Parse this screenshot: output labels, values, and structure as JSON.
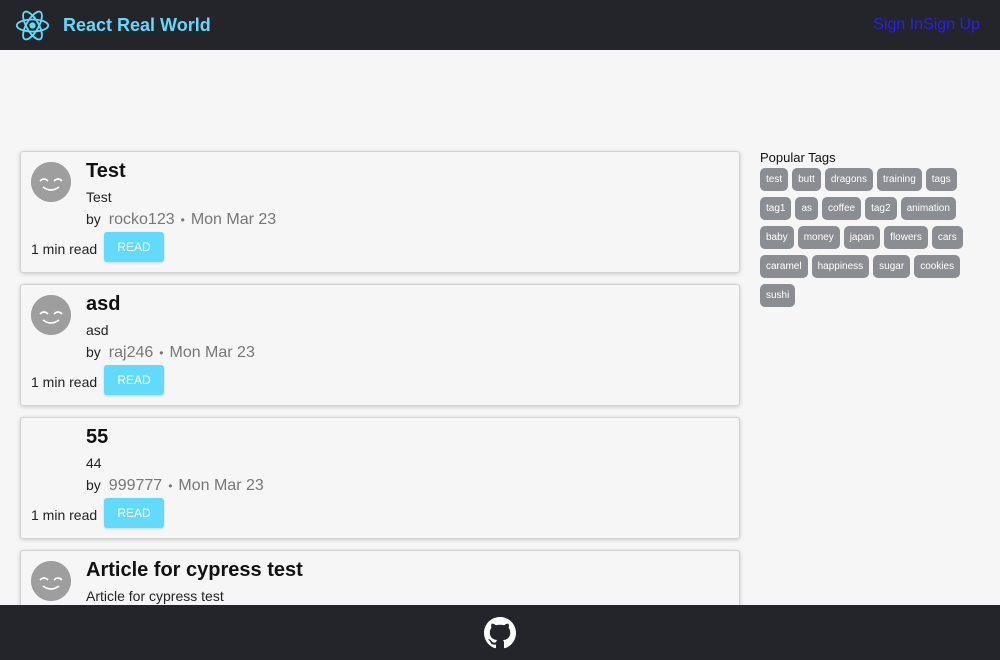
{
  "header": {
    "logo_icon": "react-atom-icon",
    "title": "React Real World",
    "sign_in": "Sign In",
    "sign_up": "Sign Up",
    "brand_color": "#61dafb",
    "link_color": "#2a1ef0"
  },
  "articles": [
    {
      "title": "Test",
      "description": "Test",
      "by": "by",
      "author": "rocko123",
      "date": "Mon Mar 23",
      "read_time": "1 min read",
      "read_label": "READ",
      "has_avatar": true
    },
    {
      "title": "asd",
      "description": "asd",
      "by": "by",
      "author": "raj246",
      "date": "Mon Mar 23",
      "read_time": "1 min read",
      "read_label": "READ",
      "has_avatar": true
    },
    {
      "title": "55",
      "description": "44",
      "by": "by",
      "author": "999777",
      "date": "Mon Mar 23",
      "read_time": "1 min read",
      "read_label": "READ",
      "has_avatar": false
    },
    {
      "title": "Article for cypress test",
      "description": "Article for cypress test",
      "by": "by",
      "author": "",
      "date": "",
      "read_time": "",
      "read_label": "",
      "has_avatar": true
    }
  ],
  "sidebar": {
    "title": "Popular Tags",
    "tags": [
      "test",
      "butt",
      "dragons",
      "training",
      "tags",
      "tag1",
      "as",
      "coffee",
      "tag2",
      "animation",
      "baby",
      "money",
      "japan",
      "flowers",
      "cars",
      "caramel",
      "happiness",
      "sugar",
      "cookies",
      "sushi"
    ]
  },
  "footer": {
    "icon": "github-icon"
  }
}
